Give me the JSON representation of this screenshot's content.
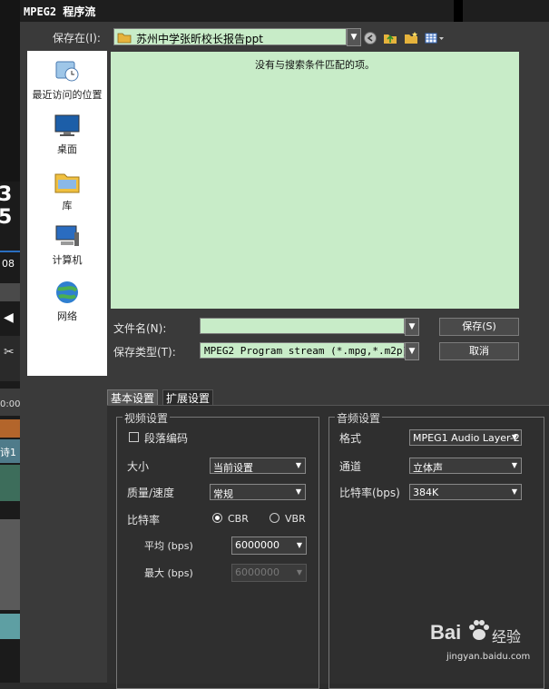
{
  "bg_app": {
    "time_fragment": "3 5",
    "counter": "08",
    "timecode_fragment": "0:00",
    "clip_fragment": "诗1"
  },
  "dialog": {
    "title": "MPEG2 程序流",
    "save_in_label": "保存在(I):",
    "save_in_value": "苏州中学张昕校长报告ppt",
    "places": [
      {
        "icon": "recent-places-icon",
        "label": "最近访问的位置"
      },
      {
        "icon": "desktop-icon",
        "label": "桌面"
      },
      {
        "icon": "library-icon",
        "label": "库"
      },
      {
        "icon": "computer-icon",
        "label": "计算机"
      },
      {
        "icon": "network-icon",
        "label": "网络"
      }
    ],
    "empty_message": "没有与搜索条件匹配的项。",
    "filename_label": "文件名(N):",
    "filename_value": "",
    "filetype_label": "保存类型(T):",
    "filetype_value": "MPEG2 Program stream (*.mpg,*.m2p)",
    "save_button": "保存(S)",
    "cancel_button": "取消"
  },
  "tabs": [
    "基本设置",
    "扩展设置"
  ],
  "video": {
    "group_title": "视频设置",
    "segment_encoding_label": "段落编码",
    "size_label": "大小",
    "size_value": "当前设置",
    "quality_label": "质量/速度",
    "quality_value": "常规",
    "bitrate_label": "比特率",
    "cbr_label": "CBR",
    "vbr_label": "VBR",
    "average_label": "平均 (bps)",
    "average_value": "6000000",
    "max_label": "最大 (bps)",
    "max_value": "6000000"
  },
  "audio": {
    "group_title": "音频设置",
    "format_label": "格式",
    "format_value": "MPEG1 Audio Layer-2",
    "channel_label": "通道",
    "channel_value": "立体声",
    "bitrate_label": "比特率(bps)",
    "bitrate_value": "384K"
  },
  "watermark": {
    "brand": "Bai",
    "brand_suffix": "经验",
    "url": "jingyan.baidu.com"
  }
}
